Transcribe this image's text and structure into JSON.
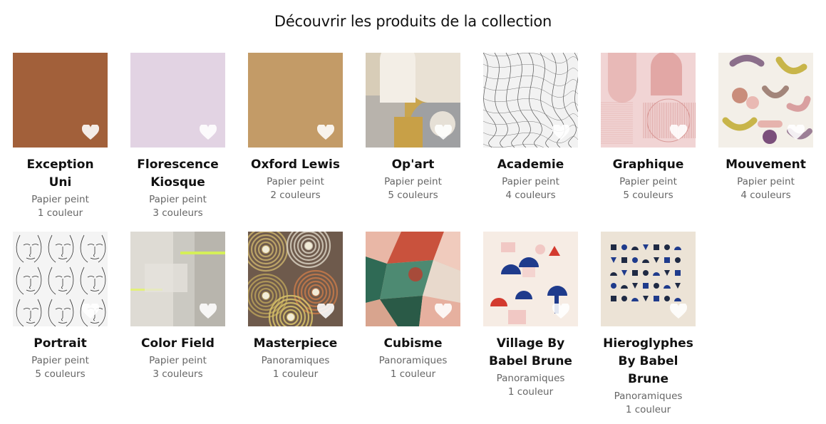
{
  "section_title": "Découvrir les produits de la collection",
  "products": [
    {
      "name": "Exception Uni",
      "type": "Papier peint",
      "colors": "1 couleur",
      "swatch": "#a2603a",
      "pattern": "plain",
      "thumb_icon": "heart-icon"
    },
    {
      "name": "Florescence Kiosque",
      "type": "Papier peint",
      "colors": "3 couleurs",
      "swatch": "#e2d3e3",
      "pattern": "plain",
      "thumb_icon": "heart-icon"
    },
    {
      "name": "Oxford Lewis",
      "type": "Papier peint",
      "colors": "2 couleurs",
      "swatch": "#c39b67",
      "pattern": "plain",
      "thumb_icon": "heart-icon"
    },
    {
      "name": "Op'art",
      "type": "Papier peint",
      "colors": "5 couleurs",
      "swatch": "#c9a54f",
      "pattern": "opart",
      "thumb_icon": "heart-icon"
    },
    {
      "name": "Academie",
      "type": "Papier peint",
      "colors": "4 couleurs",
      "swatch": "#f2f2f2",
      "pattern": "lines",
      "thumb_icon": "heart-icon"
    },
    {
      "name": "Graphique",
      "type": "Papier peint",
      "colors": "5 couleurs",
      "swatch": "#f1d4d4",
      "pattern": "graphique",
      "thumb_icon": "heart-icon"
    },
    {
      "name": "Mouvement",
      "type": "Papier peint",
      "colors": "4 couleurs",
      "swatch": "#f3efe8",
      "pattern": "mouvement",
      "thumb_icon": "heart-icon"
    },
    {
      "name": "Portrait",
      "type": "Papier peint",
      "colors": "5 couleurs",
      "swatch": "#f4f4f4",
      "pattern": "portrait",
      "thumb_icon": "heart-icon"
    },
    {
      "name": "Color Field",
      "type": "Papier peint",
      "colors": "3 couleurs",
      "swatch": "#d4d2cc",
      "pattern": "colorfield",
      "thumb_icon": "heart-icon"
    },
    {
      "name": "Masterpiece",
      "type": "Panoramiques",
      "colors": "1 couleur",
      "swatch": "#8a6b4c",
      "pattern": "masterpiece",
      "thumb_icon": "heart-icon"
    },
    {
      "name": "Cubisme",
      "type": "Panoramiques",
      "colors": "1 couleur",
      "swatch": "#e8b7a4",
      "pattern": "cubisme",
      "thumb_icon": "heart-icon"
    },
    {
      "name": "Village By Babel Brune",
      "type": "Panoramiques",
      "colors": "1 couleur",
      "swatch": "#f6ece4",
      "pattern": "village",
      "thumb_icon": "heart-icon"
    },
    {
      "name": "Hieroglyphes By Babel Brune",
      "type": "Panoramiques",
      "colors": "1 couleur",
      "swatch": "#ece3d6",
      "pattern": "hieroglyphes",
      "thumb_icon": "heart-icon"
    }
  ]
}
